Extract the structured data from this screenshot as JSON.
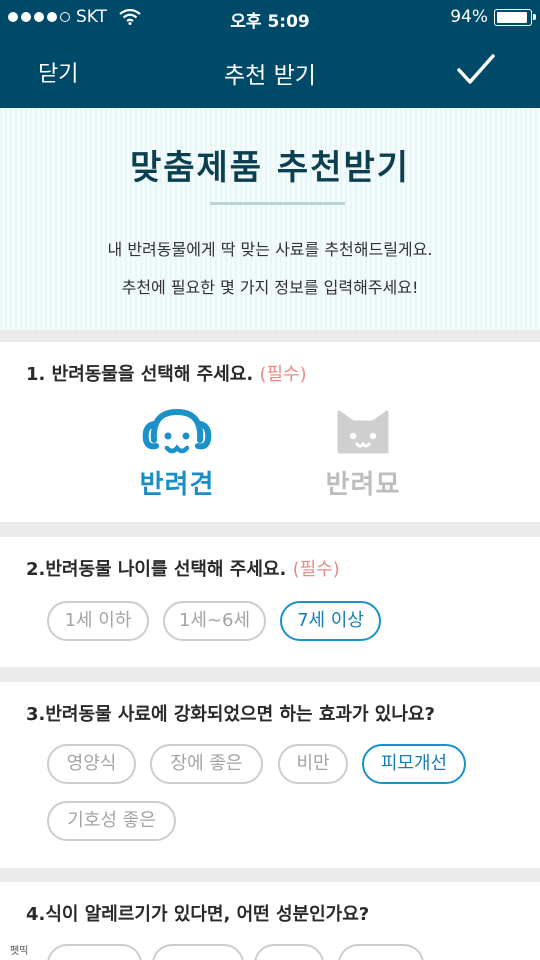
{
  "status_bar": {
    "carrier": "SKT",
    "time": "오후 5:09",
    "battery": "94%",
    "battery_level": 0.94
  },
  "nav": {
    "close": "닫기",
    "title": "추천 받기",
    "confirm_icon": "checkmark-icon"
  },
  "banner": {
    "title": "맞춤제품 추천받기",
    "line1": "내 반려동물에게 딱 맞는 사료를 추천해드릴게요.",
    "line2": "추천에 필요한 몇 가지 정보를 입력해주세요!"
  },
  "q1": {
    "title": "1. 반려동물을 선택해 주세요.",
    "required": "(필수)",
    "options": [
      {
        "label": "반려견",
        "icon": "dog-icon",
        "selected": true
      },
      {
        "label": "반려묘",
        "icon": "cat-icon",
        "selected": false
      }
    ]
  },
  "q2": {
    "title": "2.반려동물 나이를 선택해 주세요.",
    "required": "(필수)",
    "options": [
      {
        "label": "1세 이하",
        "selected": false
      },
      {
        "label": "1세~6세",
        "selected": false
      },
      {
        "label": "7세 이상",
        "selected": true
      }
    ]
  },
  "q3": {
    "title": "3.반려동물 사료에 강화되었으면 하는 효과가 있나요?",
    "options": [
      {
        "label": "영양식",
        "selected": false
      },
      {
        "label": "장에 좋은",
        "selected": false
      },
      {
        "label": "비만",
        "selected": false
      },
      {
        "label": "피모개선",
        "selected": true
      },
      {
        "label": "기호성 좋은",
        "selected": false
      }
    ]
  },
  "q4": {
    "title": "4.식이 알레르기가 있다면, 어떤 성분인가요?"
  },
  "watermark": "펫띡",
  "colors": {
    "header": "#004a69",
    "accent": "#1a92c9",
    "required": "#e88b86"
  }
}
